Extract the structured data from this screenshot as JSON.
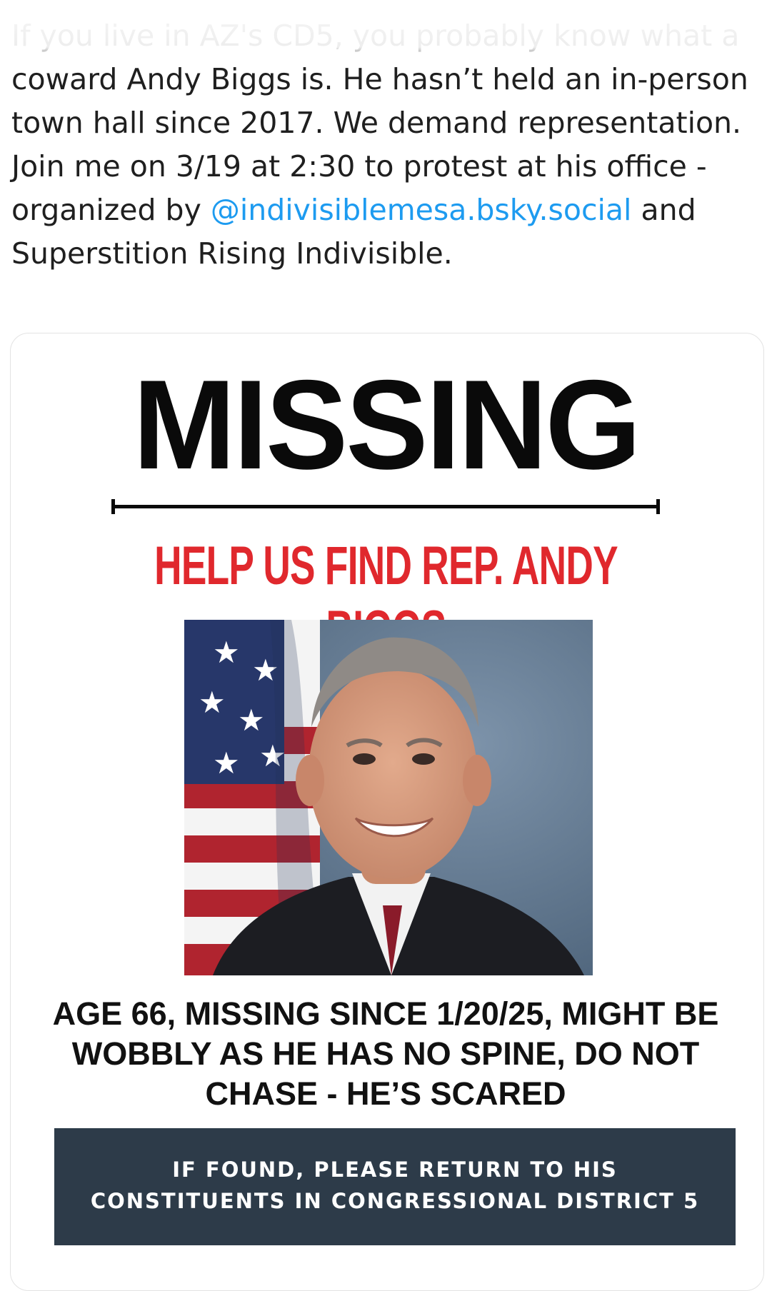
{
  "post": {
    "faded_line_1": "If you live in AZ's CD5, you probably know what",
    "faded_line_2_start": "a coward Andy Biggs",
    "text_a": " is. He hasn’t held an in-person town hall since 2017. We demand representation. Join me on 3/19 at 2:30 to protest at his office - organized by ",
    "mention": "@indivisiblemesa.bsky.social",
    "text_b": " and Superstition Rising Indivisible."
  },
  "poster": {
    "headline": "MISSING",
    "subhead": "HELP US FIND REP. ANDY BIGGS",
    "description": "AGE 66, MISSING SINCE 1/20/25, MIGHT BE WOBBLY AS HE HAS NO SPINE, DO NOT CHASE - HE’S SCARED",
    "banner_line_1": "IF FOUND, PLEASE RETURN TO HIS",
    "banner_line_2": "CONSTITUENTS IN CONGRESSIONAL DISTRICT 5",
    "colors": {
      "headline": "#0a0a0a",
      "subhead": "#e0282d",
      "banner": "#2d3b49",
      "mention": "#1d9bf0"
    }
  }
}
